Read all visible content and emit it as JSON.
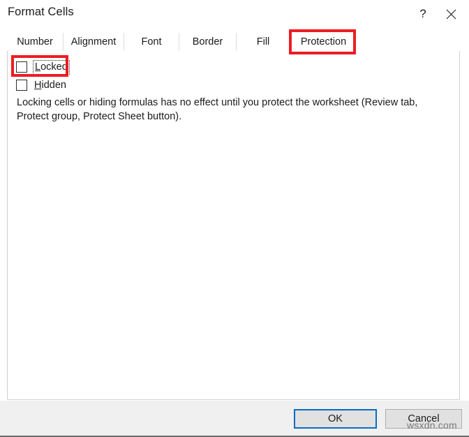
{
  "window": {
    "title": "Format Cells",
    "help_icon": "question-mark-icon",
    "help_glyph": "?",
    "close_icon": "close-x-icon"
  },
  "tabs": [
    {
      "label": "Number",
      "selected": false
    },
    {
      "label": "Alignment",
      "selected": false
    },
    {
      "label": "Font",
      "selected": false
    },
    {
      "label": "Border",
      "selected": false
    },
    {
      "label": "Fill",
      "selected": false
    },
    {
      "label": "Protection",
      "selected": true
    }
  ],
  "protection_panel": {
    "checkboxes": [
      {
        "label": "Locked",
        "accelerator": "L",
        "rest": "ocked",
        "checked": false,
        "focused": true
      },
      {
        "label": "Hidden",
        "accelerator": "H",
        "rest": "idden",
        "checked": false,
        "focused": false
      }
    ],
    "description": "Locking cells or hiding formulas has no effect until you protect the worksheet (Review tab, Protect group, Protect Sheet button)."
  },
  "footer": {
    "ok_label": "OK",
    "cancel_label": "Cancel"
  },
  "annotations": {
    "highlight_color": "#ee1c22",
    "boxes": [
      {
        "target": "Protection"
      },
      {
        "target": "Locked"
      }
    ]
  },
  "watermark": {
    "text": "wsxdn.com"
  }
}
